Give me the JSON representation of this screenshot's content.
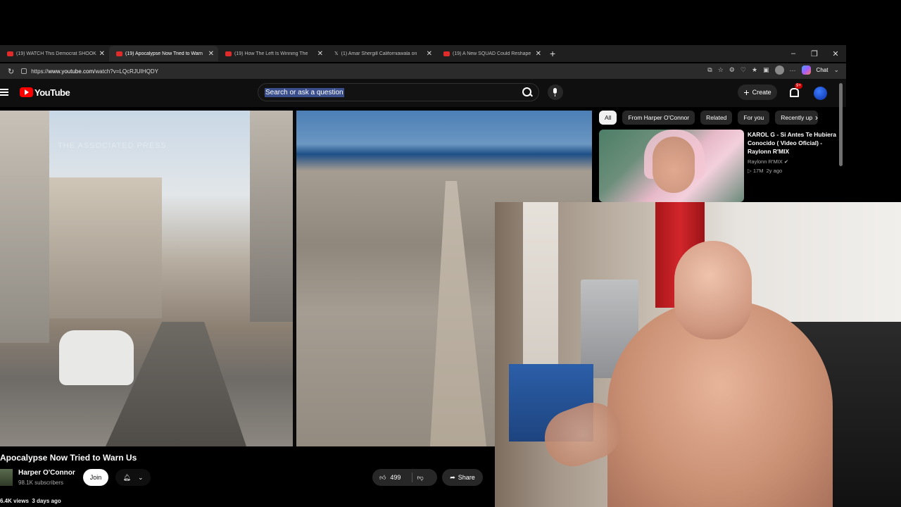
{
  "browser": {
    "tabs": [
      {
        "title": "(19) WATCH This Democrat SHOOK",
        "active": false,
        "icon": "youtube-icon"
      },
      {
        "title": "(19) Apocalypse Now Tried to Warn",
        "active": true,
        "icon": "youtube-icon"
      },
      {
        "title": "(19) How The Left Is Winning The",
        "active": false,
        "icon": "youtube-icon"
      },
      {
        "title": "(1) Amar Shergill Californiawala on",
        "active": false,
        "icon": "x-icon"
      },
      {
        "title": "(19) A New SQUAD Could Reshape",
        "active": false,
        "icon": "youtube-icon"
      }
    ],
    "url_prefix": "https://",
    "url_domain": "www.youtube.com",
    "url_path": "/watch?v=LQcRJUIHQDY",
    "chat_label": "Chat"
  },
  "youtube": {
    "logo_text": "YouTube",
    "search_placeholder": "Search or ask a question",
    "search_text": "Search or ask a question",
    "create_label": "Create",
    "notification_badge": "9+"
  },
  "video": {
    "watermark": "THE ASSOCIATED PRESS",
    "title": "Apocalypse Now Tried to Warn Us",
    "channel": "Harper O'Connor",
    "subscribers": "98.1K subscribers",
    "join_label": "Join",
    "likes": "499",
    "share_label": "Share",
    "views": "6.4K views",
    "age": "3 days ago"
  },
  "sidebar": {
    "chips": [
      "All",
      "From Harper O'Connor",
      "Related",
      "For you",
      "Recently up"
    ],
    "selected_chip": "All",
    "recommendation": {
      "title": "KAROL G - Si Antes Te Hubiera Conocido ( Video Oficial) - Raylonn R'MIX",
      "channel": "Raylonn R'MIX",
      "views": "17M",
      "age": "2y ago"
    }
  }
}
